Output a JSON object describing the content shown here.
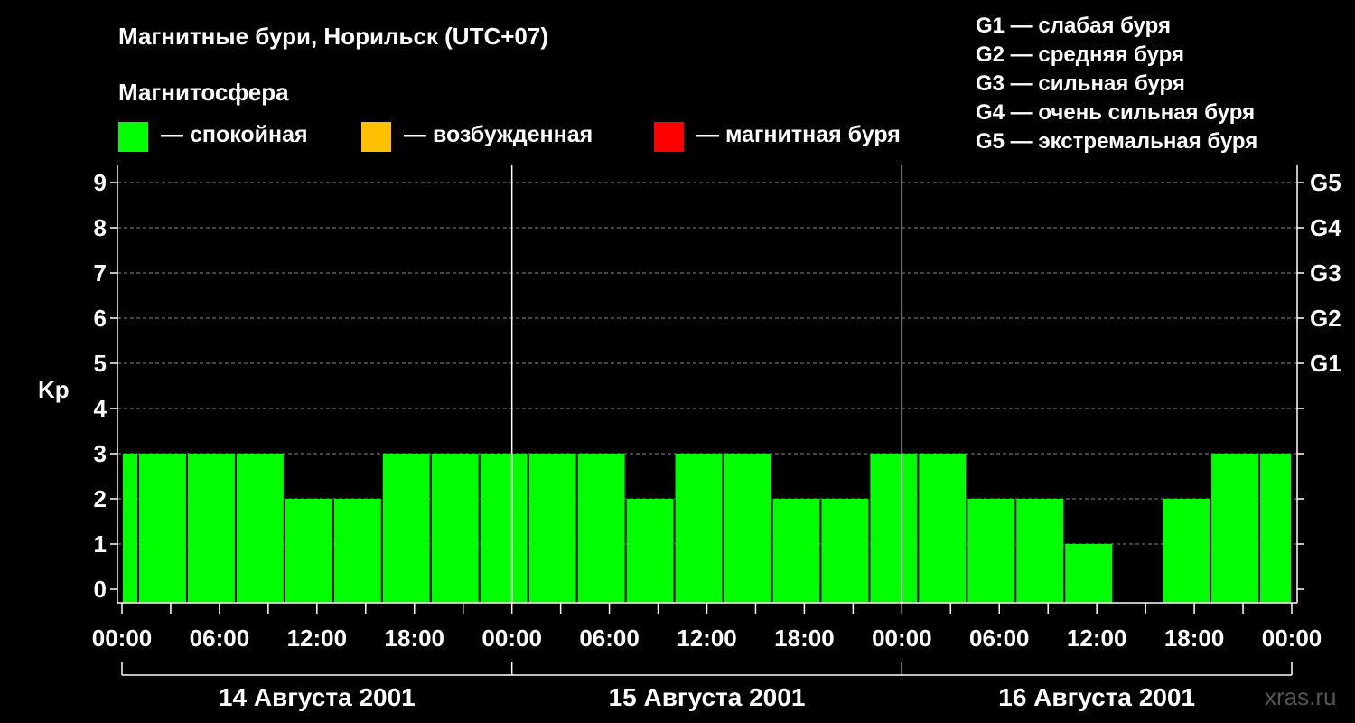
{
  "title": "Магнитные бури, Норильск (UTC+07)",
  "legend": {
    "heading": "Магнитосфера",
    "items": [
      {
        "label": "— спокойная",
        "color": "#00ff00"
      },
      {
        "label": "— возбужденная",
        "color": "#ffc000"
      },
      {
        "label": "— магнитная буря",
        "color": "#ff0000"
      }
    ]
  },
  "storm_scale": [
    "G1 — слабая буря",
    "G2 — средняя буря",
    "G3 — сильная буря",
    "G4 — очень сильная буря",
    "G5 — экстремальная буря"
  ],
  "watermark": "xras.ru",
  "chart_data": {
    "type": "bar",
    "ylabel": "Kp",
    "ylim": [
      0,
      9
    ],
    "yticks": [
      0,
      1,
      2,
      3,
      4,
      5,
      6,
      7,
      8,
      9
    ],
    "right_ticks": [
      {
        "value": 5,
        "label": "G1"
      },
      {
        "value": 6,
        "label": "G2"
      },
      {
        "value": 7,
        "label": "G3"
      },
      {
        "value": 8,
        "label": "G4"
      },
      {
        "value": 9,
        "label": "G5"
      }
    ],
    "x_range_hours": [
      0,
      72
    ],
    "xticks": [
      "00:00",
      "06:00",
      "12:00",
      "18:00",
      "00:00",
      "06:00",
      "12:00",
      "18:00",
      "00:00",
      "06:00",
      "12:00",
      "18:00",
      "00:00"
    ],
    "days": [
      "14 Августа 2001",
      "15 Августа 2001",
      "16 Августа 2001"
    ],
    "bars": [
      {
        "start": 0,
        "end": 1,
        "value": 3
      },
      {
        "start": 1,
        "end": 4,
        "value": 3
      },
      {
        "start": 4,
        "end": 7,
        "value": 3
      },
      {
        "start": 7,
        "end": 10,
        "value": 3
      },
      {
        "start": 10,
        "end": 13,
        "value": 2
      },
      {
        "start": 13,
        "end": 16,
        "value": 2
      },
      {
        "start": 16,
        "end": 19,
        "value": 3
      },
      {
        "start": 19,
        "end": 22,
        "value": 3
      },
      {
        "start": 22,
        "end": 25,
        "value": 3
      },
      {
        "start": 25,
        "end": 28,
        "value": 3
      },
      {
        "start": 28,
        "end": 31,
        "value": 3
      },
      {
        "start": 31,
        "end": 34,
        "value": 2
      },
      {
        "start": 34,
        "end": 37,
        "value": 3
      },
      {
        "start": 37,
        "end": 40,
        "value": 3
      },
      {
        "start": 40,
        "end": 43,
        "value": 2
      },
      {
        "start": 43,
        "end": 46,
        "value": 2
      },
      {
        "start": 46,
        "end": 49,
        "value": 3
      },
      {
        "start": 49,
        "end": 52,
        "value": 3
      },
      {
        "start": 52,
        "end": 55,
        "value": 2
      },
      {
        "start": 55,
        "end": 58,
        "value": 2
      },
      {
        "start": 58,
        "end": 61,
        "value": 1
      },
      {
        "start": 64,
        "end": 67,
        "value": 2
      },
      {
        "start": 67,
        "end": 70,
        "value": 3
      },
      {
        "start": 70,
        "end": 72,
        "value": 3
      }
    ],
    "bar_color": "#00ff00",
    "grid": true
  }
}
